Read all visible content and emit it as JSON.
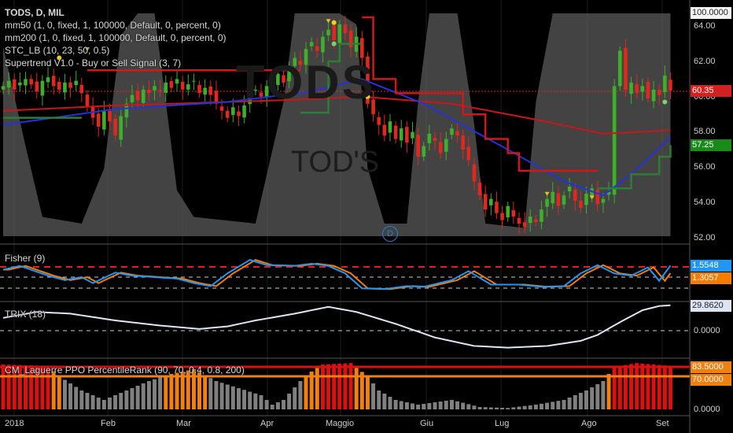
{
  "header": {
    "title": "TODS, D, MIL",
    "studies": [
      "mm50 (1, 0, fixed, 1, 100000, Default, 0, percent, 0)",
      "mm200 (1, 0, fixed, 1, 100000, Default, 0, percent, 0)",
      "STC_LB (10, 23, 50, 0.5)",
      "Supertrend V1.0 - Buy or Sell Signal (3, 7)"
    ]
  },
  "watermark": {
    "symbol": "TODS",
    "company": "TOD'S"
  },
  "colors": {
    "up": "#3fae2a",
    "down": "#e0281e",
    "mm50": "#2233dd",
    "mm200": "#cc1515",
    "stc": "#8a8a8a",
    "fisher": "#2196f3",
    "trigger": "#f57c00",
    "trix": "#dfe6f5",
    "lag_red": "#dd1010",
    "lag_orange": "#f08010",
    "lag_gray": "#808080"
  },
  "event_marker": "D",
  "chart_data": [
    {
      "type": "candlestick",
      "title": "TODS, D, MIL",
      "ylim": [
        51.8,
        65
      ],
      "y_ticks": [
        "64.00",
        "62.00",
        "60.00",
        "58.00",
        "56.00",
        "54.00",
        "52.00"
      ],
      "x_ticks": [
        "2018",
        "Feb",
        "Mar",
        "Apr",
        "Maggio",
        "Giu",
        "Lug",
        "Ago",
        "Set"
      ],
      "last_price": "60.35",
      "supertrend_value": "57.25",
      "stc_top_label": "100.0000",
      "close": [
        60.6,
        60.9,
        60.4,
        60.8,
        61.0,
        60.7,
        60.3,
        60.9,
        61.1,
        60.6,
        60.4,
        60.8,
        60.5,
        60.9,
        60.2,
        59.4,
        58.8,
        58.3,
        59.2,
        58.6,
        57.8,
        58.9,
        59.6,
        60.1,
        59.8,
        60.4,
        60.2,
        60.6,
        60.3,
        60.8,
        60.5,
        61.0,
        60.4,
        60.7,
        60.9,
        60.2,
        60.5,
        60.1,
        59.6,
        59.2,
        58.8,
        59.4,
        58.9,
        59.5,
        60.1,
        60.4,
        60.0,
        60.6,
        60.9,
        61.3,
        60.8,
        61.5,
        62.2,
        61.8,
        62.7,
        63.1,
        62.6,
        63.4,
        63.8,
        63.2,
        64.1,
        63.6,
        62.8,
        63.4,
        62.2,
        59.6,
        59.0,
        58.4,
        57.8,
        58.6,
        57.6,
        58.2,
        57.4,
        58.0,
        56.6,
        57.2,
        57.9,
        57.5,
        56.8,
        57.6,
        58.2,
        57.8,
        57.0,
        56.4,
        55.2,
        54.4,
        53.6,
        54.2,
        53.4,
        53.0,
        53.8,
        53.2,
        52.8,
        52.6,
        53.2,
        52.9,
        53.6,
        54.2,
        54.6,
        53.8,
        54.4,
        54.9,
        54.1,
        53.7,
        54.5,
        54.8,
        53.9,
        54.2,
        54.6,
        60.6,
        62.6,
        60.4,
        60.8,
        60.2,
        60.6,
        59.9,
        60.4,
        60.1,
        61.2,
        60.35
      ],
      "mm50": [
        [
          0,
          58.4
        ],
        [
          20,
          59.3
        ],
        [
          40,
          59.7
        ],
        [
          55,
          60.3
        ],
        [
          64,
          61.0
        ],
        [
          75,
          59.6
        ],
        [
          90,
          57.0
        ],
        [
          100,
          55.2
        ],
        [
          107,
          54.4
        ],
        [
          112,
          55.6
        ],
        [
          119,
          57.7
        ]
      ],
      "mm200": [
        [
          0,
          59.2
        ],
        [
          20,
          59.5
        ],
        [
          50,
          59.8
        ],
        [
          64,
          60.0
        ],
        [
          80,
          59.6
        ],
        [
          95,
          58.7
        ],
        [
          107,
          57.9
        ],
        [
          119,
          58.1
        ]
      ],
      "supertrend": [
        {
          "trend": "up",
          "points": [
            [
              0,
              58.8
            ],
            [
              14,
              58.8
            ]
          ]
        },
        {
          "trend": "down",
          "points": [
            [
              15,
              61.5
            ],
            [
              53,
              61.5
            ]
          ]
        },
        {
          "trend": "up",
          "points": [
            [
              53,
              59.1
            ],
            [
              57,
              59.1
            ],
            [
              58,
              62.0
            ],
            [
              60,
              63.0
            ],
            [
              64,
              63.0
            ]
          ]
        },
        {
          "trend": "down",
          "points": [
            [
              64,
              64.5
            ],
            [
              66,
              61.0
            ],
            [
              70,
              60.2
            ],
            [
              78,
              60.2
            ],
            [
              82,
              59.0
            ],
            [
              86,
              57.6
            ],
            [
              90,
              56.8
            ],
            [
              92,
              55.8
            ],
            [
              106,
              55.8
            ]
          ]
        },
        {
          "trend": "up",
          "points": [
            [
              106,
              54.8
            ],
            [
              110,
              54.8
            ],
            [
              112,
              55.6
            ],
            [
              115,
              55.6
            ],
            [
              117,
              56.6
            ],
            [
              119,
              57.25
            ]
          ]
        }
      ],
      "stc": [
        [
          0,
          85
        ],
        [
          4,
          40
        ],
        [
          7,
          8
        ],
        [
          14,
          5
        ],
        [
          18,
          30
        ],
        [
          21,
          90
        ],
        [
          24,
          100
        ],
        [
          27,
          100
        ],
        [
          29,
          60
        ],
        [
          31,
          20
        ],
        [
          34,
          8
        ],
        [
          45,
          5
        ],
        [
          50,
          60
        ],
        [
          52,
          100
        ],
        [
          60,
          100
        ],
        [
          63,
          95
        ],
        [
          65,
          30
        ],
        [
          68,
          5
        ],
        [
          72,
          5
        ],
        [
          74,
          60
        ],
        [
          76,
          100
        ],
        [
          81,
          100
        ],
        [
          84,
          50
        ],
        [
          86,
          5
        ],
        [
          93,
          3
        ],
        [
          95,
          60
        ],
        [
          98,
          100
        ],
        [
          119,
          100
        ]
      ]
    },
    {
      "type": "line",
      "title": "Fisher (9)",
      "series": [
        {
          "name": "Fisher",
          "last": "1.5548",
          "points": [
            [
              0,
              1
            ],
            [
              3,
              1.5
            ],
            [
              8,
              0.2
            ],
            [
              11,
              -0.4
            ],
            [
              14,
              0
            ],
            [
              16,
              -0.8
            ],
            [
              20,
              0.6
            ],
            [
              23,
              0.2
            ],
            [
              27,
              0
            ],
            [
              31,
              -0.2
            ],
            [
              34,
              -0.8
            ],
            [
              37,
              -1.2
            ],
            [
              40,
              0.5
            ],
            [
              44,
              2.3
            ],
            [
              47,
              1.6
            ],
            [
              52,
              1.5
            ],
            [
              55,
              1.8
            ],
            [
              58,
              1.5
            ],
            [
              61,
              0.5
            ],
            [
              64,
              -1.5
            ],
            [
              68,
              -1.6
            ],
            [
              72,
              -1.2
            ],
            [
              75,
              -1.3
            ],
            [
              80,
              -0.4
            ],
            [
              83,
              0.8
            ],
            [
              87,
              -1.0
            ],
            [
              92,
              -1.0
            ],
            [
              96,
              -1.3
            ],
            [
              100,
              -1.2
            ],
            [
              103,
              0.5
            ],
            [
              106,
              1.6
            ],
            [
              109,
              0.5
            ],
            [
              112,
              0.2
            ],
            [
              115,
              1.3
            ],
            [
              117,
              -0.5
            ],
            [
              119,
              1.55
            ]
          ]
        },
        {
          "name": "Trigger",
          "last": "1.3057"
        }
      ],
      "levels": [
        1.5,
        0,
        -1.5
      ]
    },
    {
      "type": "line",
      "title": "TRIX (18)",
      "last": "29.8620",
      "zero_label": "0.0000",
      "points": [
        [
          0,
          15
        ],
        [
          6,
          22
        ],
        [
          12,
          20
        ],
        [
          20,
          12
        ],
        [
          28,
          6
        ],
        [
          35,
          2
        ],
        [
          40,
          5
        ],
        [
          45,
          12
        ],
        [
          52,
          20
        ],
        [
          58,
          28
        ],
        [
          63,
          22
        ],
        [
          70,
          8
        ],
        [
          77,
          -8
        ],
        [
          84,
          -18
        ],
        [
          90,
          -20
        ],
        [
          97,
          -18
        ],
        [
          103,
          -12
        ],
        [
          106,
          -5
        ],
        [
          110,
          10
        ],
        [
          114,
          24
        ],
        [
          117,
          29
        ],
        [
          119,
          29.9
        ]
      ]
    },
    {
      "type": "bar",
      "title": "CM_Laguerre PPO PercentileRank (90, 70, 0.4, 0.8, 200)",
      "labels": [
        "83.5000",
        "70.0000",
        "0.0000"
      ],
      "thresholds": [
        90,
        70
      ],
      "points": [
        [
          0,
          95
        ],
        [
          8,
          92
        ],
        [
          10,
          70
        ],
        [
          14,
          40
        ],
        [
          18,
          20
        ],
        [
          22,
          40
        ],
        [
          26,
          60
        ],
        [
          30,
          75
        ],
        [
          34,
          85
        ],
        [
          38,
          60
        ],
        [
          42,
          45
        ],
        [
          46,
          30
        ],
        [
          48,
          10
        ],
        [
          50,
          20
        ],
        [
          53,
          60
        ],
        [
          55,
          80
        ],
        [
          57,
          95
        ],
        [
          62,
          98
        ],
        [
          65,
          70
        ],
        [
          67,
          40
        ],
        [
          70,
          20
        ],
        [
          74,
          10
        ],
        [
          80,
          20
        ],
        [
          85,
          5
        ],
        [
          90,
          3
        ],
        [
          95,
          10
        ],
        [
          100,
          20
        ],
        [
          104,
          40
        ],
        [
          107,
          60
        ],
        [
          109,
          90
        ],
        [
          113,
          98
        ],
        [
          116,
          95
        ],
        [
          119,
          92
        ]
      ]
    }
  ]
}
